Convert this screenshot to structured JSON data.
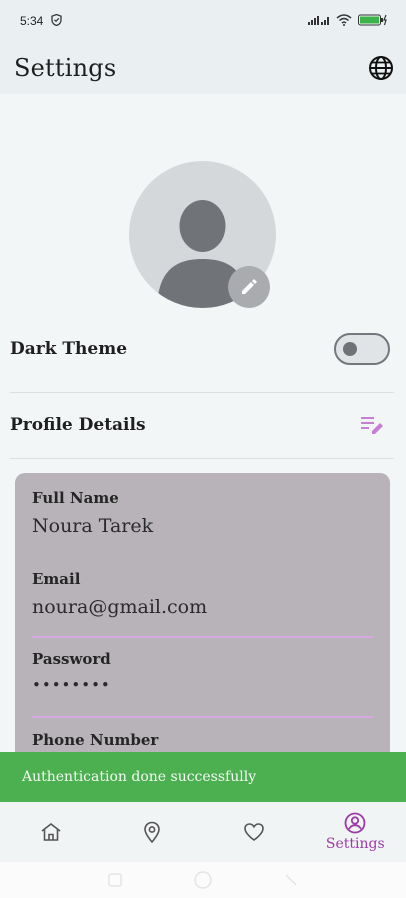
{
  "status_bar": {
    "time": "5:34"
  },
  "app_bar": {
    "title": "Settings",
    "globe_icon": "globe-icon"
  },
  "settings": {
    "dark_theme_label": "Dark Theme",
    "dark_theme_on": false,
    "profile_details_label": "Profile Details"
  },
  "profile": {
    "full_name_label": "Full Name",
    "full_name_value": "Noura Tarek",
    "email_label": "Email",
    "email_value": "noura@gmail.com",
    "password_label": "Password",
    "password_value": "••••••••",
    "phone_label": "Phone Number"
  },
  "snackbar": {
    "message": "Authentication done successfully"
  },
  "bottom_nav": {
    "items": [
      {
        "icon": "home-icon"
      },
      {
        "icon": "location-pin-icon"
      },
      {
        "icon": "heart-icon"
      },
      {
        "icon": "account-circle-icon",
        "label": "Settings",
        "active": true
      }
    ]
  },
  "colors": {
    "accent": "#9c3aa8",
    "snackbar": "#4caf50",
    "card": "#b7b3b9",
    "field_underline": "#d8a8e4"
  }
}
